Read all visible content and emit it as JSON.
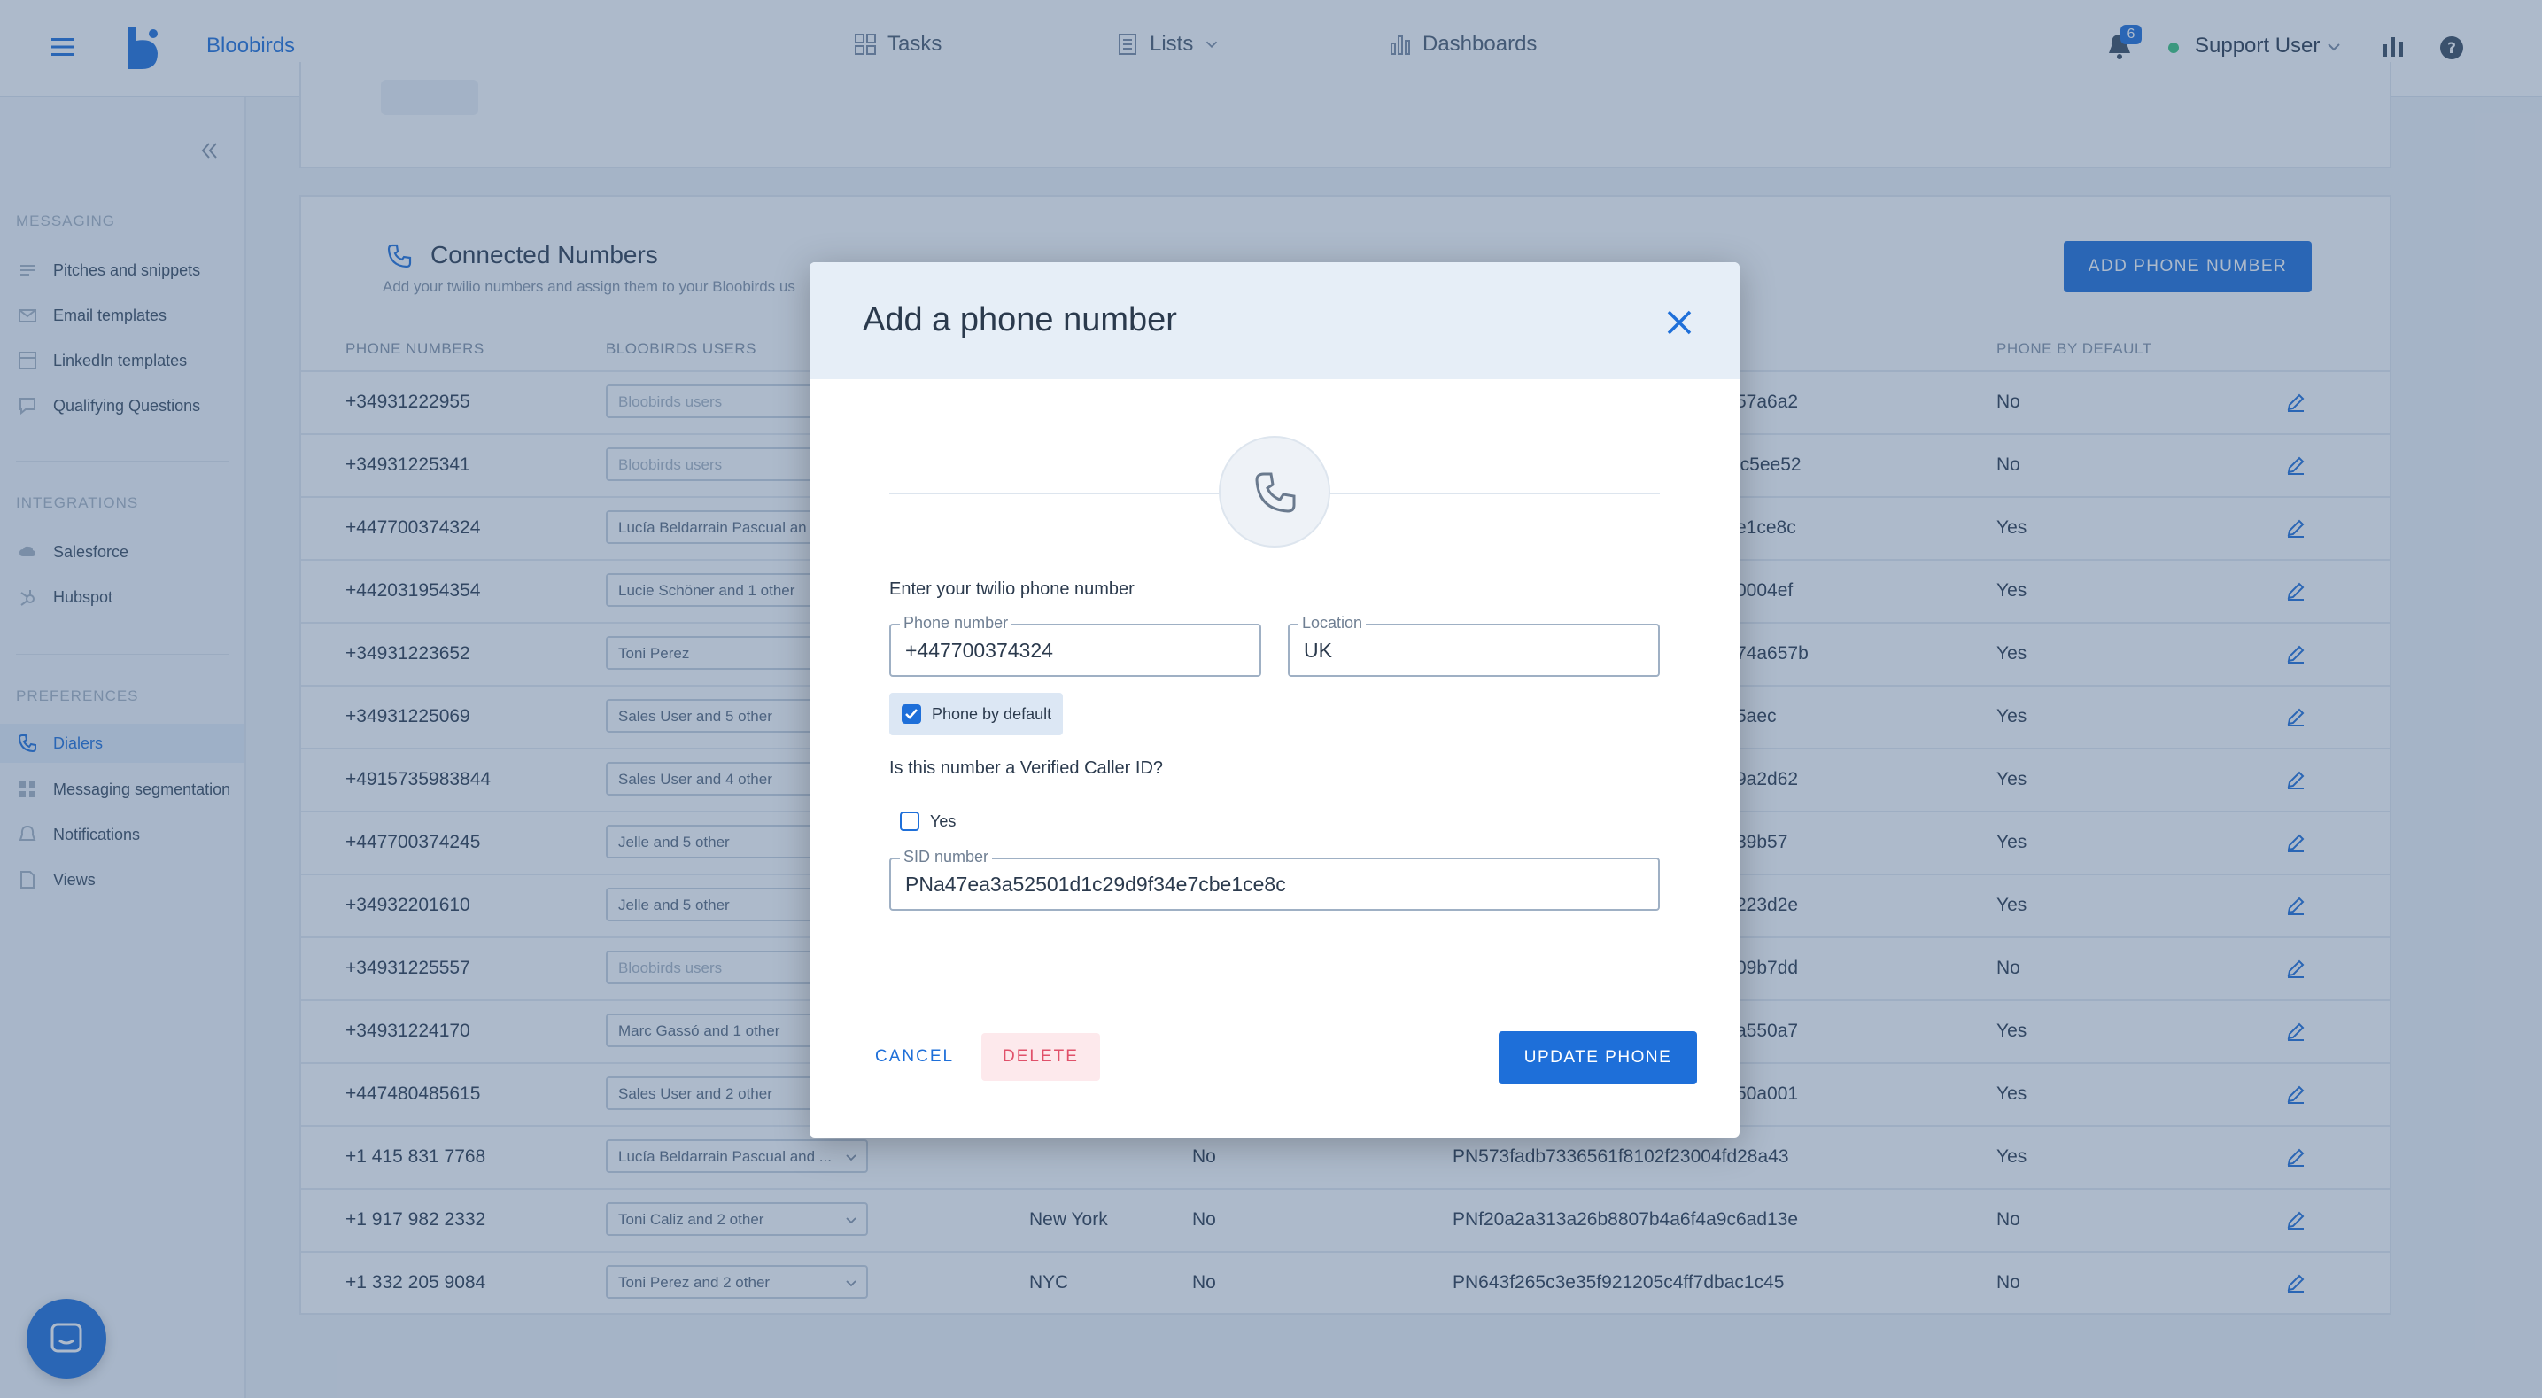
{
  "topbar": {
    "brand": "Bloobirds",
    "nav": [
      {
        "label": "Tasks",
        "icon": "grid-icon"
      },
      {
        "label": "Lists",
        "icon": "list-icon"
      },
      {
        "label": "Dashboards",
        "icon": "bar-chart-icon"
      }
    ],
    "notifications_count": "6",
    "user": "Support User"
  },
  "sidebar": {
    "sections": [
      {
        "title": "MESSAGING",
        "items": [
          "Pitches and snippets",
          "Email templates",
          "LinkedIn templates",
          "Qualifying Questions"
        ]
      },
      {
        "title": "INTEGRATIONS",
        "items": [
          "Salesforce",
          "Hubspot"
        ]
      },
      {
        "title": "PREFERENCES",
        "items": [
          "Dialers",
          "Messaging segmentation",
          "Notifications",
          "Views"
        ]
      }
    ],
    "active_item": "Dialers"
  },
  "connected": {
    "title": "Connected Numbers",
    "subtitle": "Add your twilio numbers and assign them to your Bloobirds us",
    "add_button": "ADD PHONE NUMBER",
    "headers": {
      "phone": "PHONE NUMBERS",
      "users": "BLOOBIRDS USERS",
      "default": "PHONE BY DEFAULT"
    },
    "rows": [
      {
        "phone": "+34931222955",
        "users": "Bloobirds users",
        "placeholder": true,
        "location": "",
        "verified": "",
        "sid": "57a6a2",
        "default": "No"
      },
      {
        "phone": "+34931225341",
        "users": "Bloobirds users",
        "placeholder": true,
        "location": "",
        "verified": "",
        "sid": "lc5ee52",
        "default": "No"
      },
      {
        "phone": "+447700374324",
        "users": "Lucía Beldarrain Pascual an",
        "placeholder": false,
        "location": "",
        "verified": "",
        "sid": "e1ce8c",
        "default": "Yes"
      },
      {
        "phone": "+442031954354",
        "users": "Lucie Schöner and 1 other",
        "placeholder": false,
        "location": "",
        "verified": "",
        "sid": "0004ef",
        "default": "Yes"
      },
      {
        "phone": "+34931223652",
        "users": "Toni Perez",
        "placeholder": false,
        "location": "",
        "verified": "",
        "sid": "74a657b",
        "default": "Yes"
      },
      {
        "phone": "+34931225069",
        "users": "Sales User and 5 other",
        "placeholder": false,
        "location": "",
        "verified": "",
        "sid": "5aec",
        "default": "Yes"
      },
      {
        "phone": "+4915735983844",
        "users": "Sales User and 4 other",
        "placeholder": false,
        "location": "",
        "verified": "",
        "sid": "9a2d62",
        "default": "Yes"
      },
      {
        "phone": "+447700374245",
        "users": "Jelle and 5 other",
        "placeholder": false,
        "location": "",
        "verified": "",
        "sid": "39b57",
        "default": "Yes"
      },
      {
        "phone": "+34932201610",
        "users": "Jelle and 5 other",
        "placeholder": false,
        "location": "",
        "verified": "",
        "sid": "223d2e",
        "default": "Yes"
      },
      {
        "phone": "+34931225557",
        "users": "Bloobirds users",
        "placeholder": true,
        "location": "",
        "verified": "",
        "sid": "09b7dd",
        "default": "No"
      },
      {
        "phone": "+34931224170",
        "users": "Marc Gassó and 1 other",
        "placeholder": false,
        "location": "",
        "verified": "",
        "sid": "a550a7",
        "default": "Yes"
      },
      {
        "phone": "+447480485615",
        "users": "Sales User and 2 other",
        "placeholder": false,
        "location": "",
        "verified": "",
        "sid": "50a001",
        "default": "Yes"
      },
      {
        "phone": "+1 415 831 7768",
        "users": "Lucía Beldarrain Pascual and ...",
        "placeholder": false,
        "location": "",
        "verified": "No",
        "sid": "PN573fadb7336561f8102f23004fd28a43",
        "default": "Yes"
      },
      {
        "phone": "+1 917 982 2332",
        "users": "Toni Caliz and 2 other",
        "placeholder": false,
        "location": "New York",
        "verified": "No",
        "sid": "PNf20a2a313a26b8807b4a6f4a9c6ad13e",
        "default": "No"
      },
      {
        "phone": "+1 332 205 9084",
        "users": "Toni Perez and 2 other",
        "placeholder": false,
        "location": "NYC",
        "verified": "No",
        "sid": "PN643f265c3e35f921205c4ff7dbac1c45",
        "default": "No"
      }
    ]
  },
  "modal": {
    "title": "Add a phone number",
    "prompt": "Enter your twilio phone number",
    "phone_label": "Phone number",
    "phone_value": "+447700374324",
    "location_label": "Location",
    "location_value": "UK",
    "default_label": "Phone by default",
    "verified_question": "Is this number a Verified Caller ID?",
    "yes_label": "Yes",
    "sid_label": "SID number",
    "sid_value": "PNa47ea3a52501d1c29d9f34e7cbe1ce8c",
    "cancel": "CANCEL",
    "delete": "DELETE",
    "update": "UPDATE PHONE"
  }
}
